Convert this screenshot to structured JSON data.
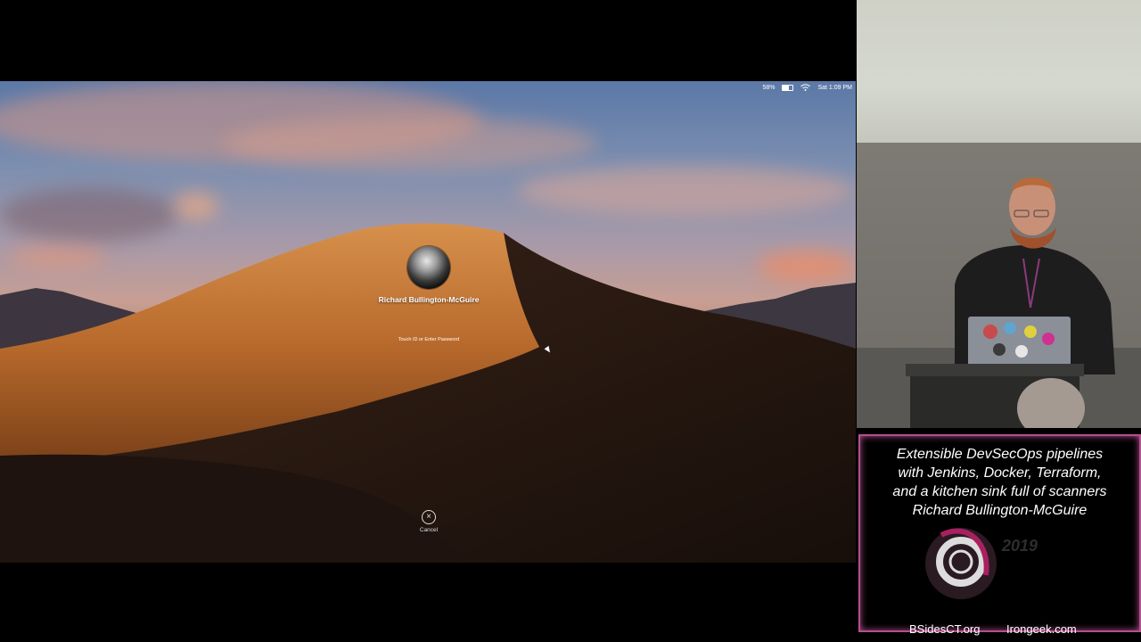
{
  "menubar": {
    "battery_percent": "58%",
    "clock": "Sat 1:09 PM"
  },
  "login": {
    "user_name": "Richard Bullington-McGuire",
    "password_hint": "Touch ID or Enter Password",
    "cancel_icon": "close-icon",
    "cancel_label": "Cancel"
  },
  "talk_card": {
    "title_lines": [
      "Extensible DevSecOps pipelines",
      "with Jenkins, Docker, Terraform,",
      "and a kitchen sink full of scanners",
      "Richard Bullington-McGuire"
    ],
    "year": "2019",
    "footer_left": "BSidesCT.org",
    "footer_right": "Irongeek.com",
    "border_color": "#b4508f"
  }
}
